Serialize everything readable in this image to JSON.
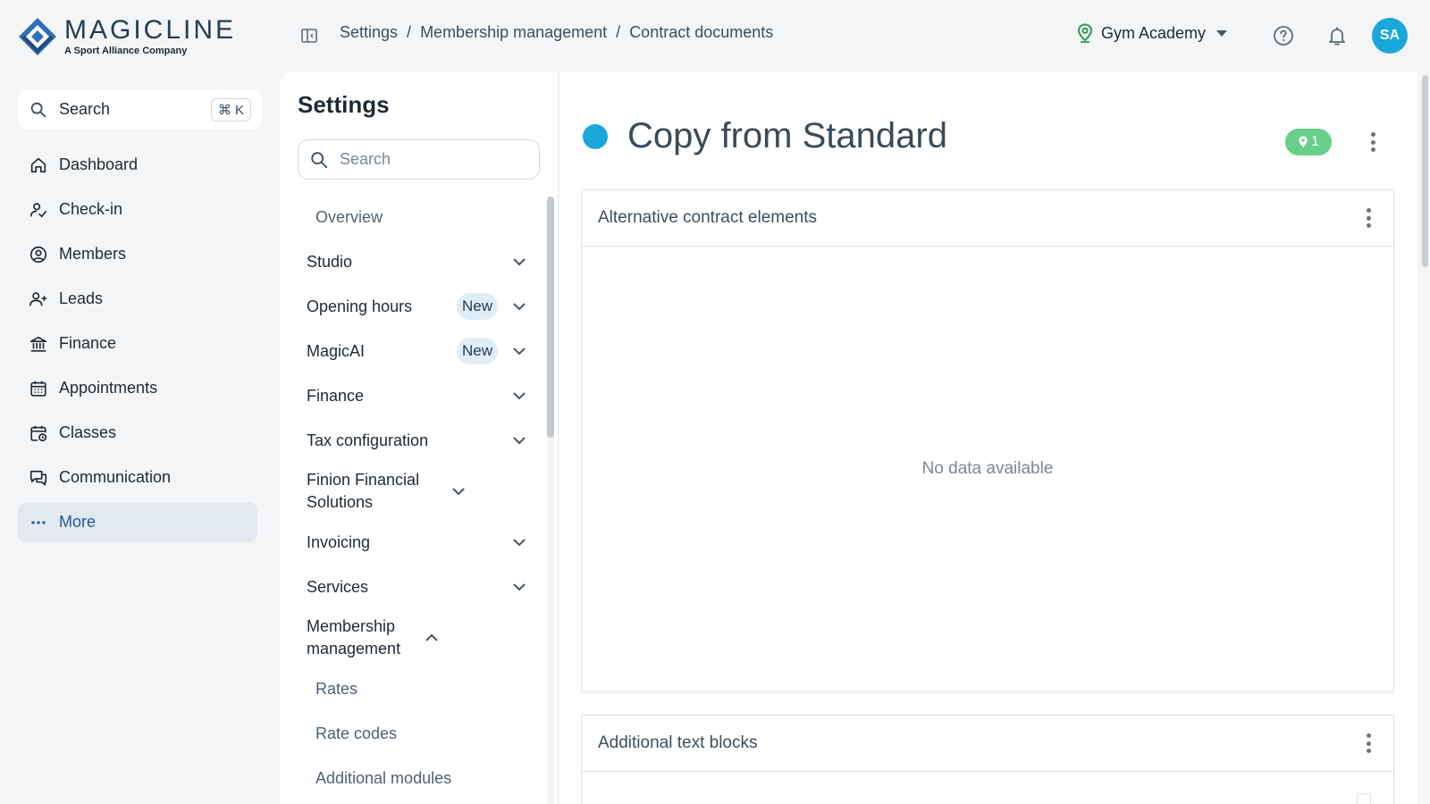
{
  "brand": {
    "title": "MAGICLINE",
    "subtitle": "A Sport Alliance Company"
  },
  "breadcrumb": [
    "Settings",
    "Membership management",
    "Contract documents"
  ],
  "header": {
    "studio": "Gym Academy",
    "avatar_initials": "SA"
  },
  "global_search": {
    "label": "Search",
    "shortcut": "⌘ K"
  },
  "nav": {
    "items": [
      {
        "label": "Dashboard",
        "icon": "home-icon"
      },
      {
        "label": "Check-in",
        "icon": "check-in-icon"
      },
      {
        "label": "Members",
        "icon": "members-icon"
      },
      {
        "label": "Leads",
        "icon": "leads-icon"
      },
      {
        "label": "Finance",
        "icon": "bank-icon"
      },
      {
        "label": "Appointments",
        "icon": "calendar-icon"
      },
      {
        "label": "Classes",
        "icon": "classes-calendar-icon"
      },
      {
        "label": "Communication",
        "icon": "chat-icon"
      },
      {
        "label": "More",
        "icon": "more-dots-icon",
        "active": true
      }
    ]
  },
  "settings": {
    "title": "Settings",
    "search_placeholder": "Search",
    "items": [
      {
        "label": "Overview"
      },
      {
        "label": "Studio"
      },
      {
        "label": "Opening hours",
        "badge": "New"
      },
      {
        "label": "MagicAI",
        "badge": "New"
      },
      {
        "label": "Finance"
      },
      {
        "label": "Tax configuration"
      },
      {
        "label": "Finion Financial Solutions"
      },
      {
        "label": "Invoicing"
      },
      {
        "label": "Services"
      },
      {
        "label": "Membership management",
        "expanded": true
      },
      {
        "label": "Rates"
      },
      {
        "label": "Rate codes"
      },
      {
        "label": "Additional modules"
      }
    ]
  },
  "document": {
    "title": "Copy from Standard",
    "status_color": "#1aa7d9",
    "location_count": "1",
    "sections": [
      {
        "title": "Alternative contract elements",
        "empty_text": "No data available"
      },
      {
        "title": "Additional text blocks"
      }
    ]
  },
  "colors": {
    "accent": "#1aa7d9",
    "nav_active_bg": "#e2e9f0",
    "nav_active_text": "#20599c",
    "location_badge": "#67cf89"
  }
}
